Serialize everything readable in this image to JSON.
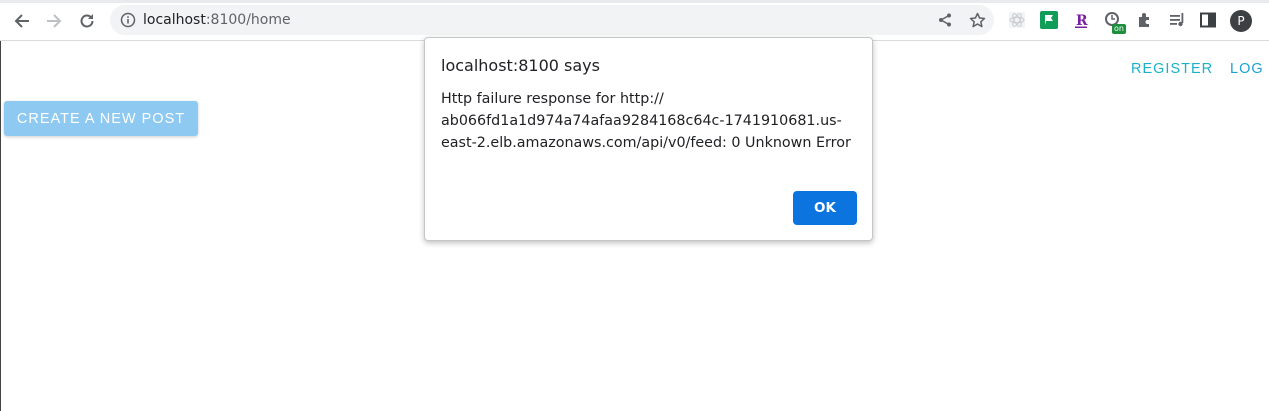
{
  "browser": {
    "url_host": "localhost",
    "url_path": ":8100/home",
    "profile_initial": "P",
    "extension_badge": "on",
    "icons": [
      "back-icon",
      "forward-icon",
      "reload-icon",
      "info-icon",
      "share-icon",
      "bookmark-star-icon",
      "extension-react-icon",
      "extension-flag-icon",
      "extension-r-icon",
      "extension-timer-icon",
      "extensions-puzzle-icon",
      "reading-list-icon",
      "side-panel-icon"
    ]
  },
  "header": {
    "register_label": "REGISTER",
    "login_label": "LOG I"
  },
  "main": {
    "create_post_label": "CREATE A NEW POST"
  },
  "dialog": {
    "title": "localhost:8100 says",
    "message_lines": [
      "Http failure response for http://",
      "ab066fd1a1d974a74afaa9284168c64c-1741910681.us-",
      "east-2.elb.amazonaws.com/api/v0/feed: 0 Unknown Error"
    ],
    "ok_label": "OK"
  },
  "colors": {
    "accent_teal": "#1ab2c9",
    "create_button_bg": "#8ec9f2",
    "ok_button_bg": "#0b74de"
  }
}
